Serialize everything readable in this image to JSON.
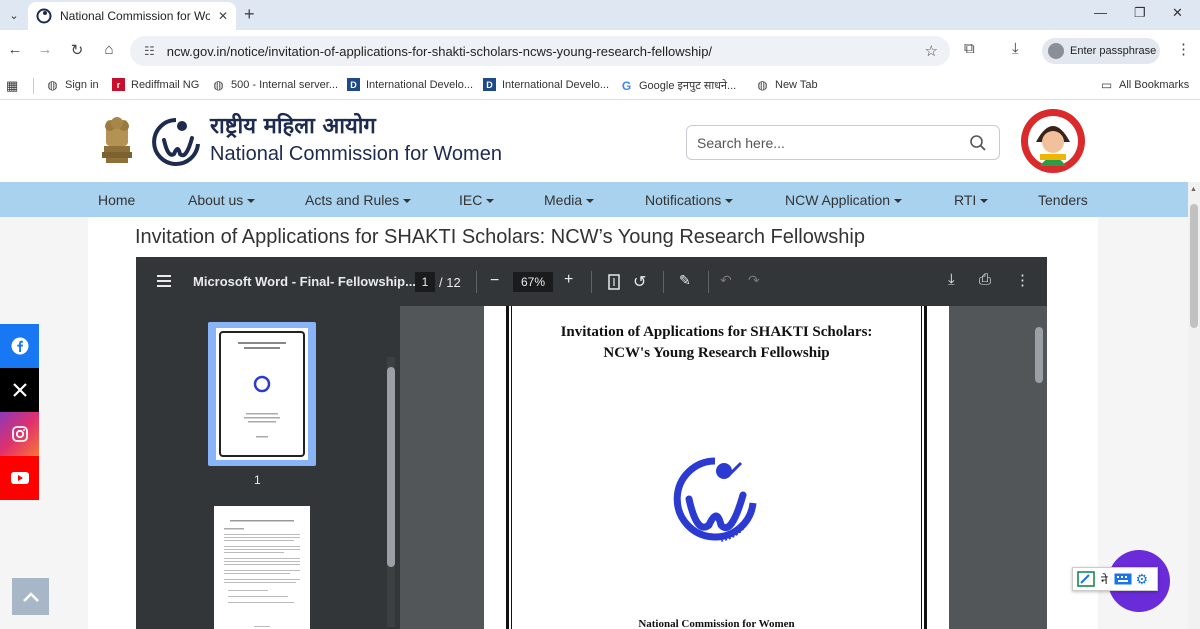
{
  "browser": {
    "tab_title": "National Commission for Women",
    "new_tab_symbol": "+",
    "url": "ncw.gov.in/notice/invitation-of-applications-for-shakti-scholars-ncws-young-research-fellowship/",
    "profile_label": "Enter passphrase"
  },
  "bookmarks": [
    {
      "label": "Sign in",
      "icon": "globe-icon"
    },
    {
      "label": "Rediffmail NG",
      "icon": "rediff-icon"
    },
    {
      "label": "500 - Internal server...",
      "icon": "globe-icon"
    },
    {
      "label": "International Develo...",
      "icon": "doc-icon"
    },
    {
      "label": "International Develo...",
      "icon": "doc-icon"
    },
    {
      "label": "Google इनपुट साधने...",
      "icon": "google-icon"
    },
    {
      "label": "New Tab",
      "icon": "globe-icon"
    }
  ],
  "bookmarks_all": "All Bookmarks",
  "site": {
    "hindi_title": "राष्ट्रीय महिला आयोग",
    "english_title": "National Commission for Women",
    "search_placeholder": "Search here..."
  },
  "nav": [
    {
      "label": "Home",
      "dropdown": false
    },
    {
      "label": "About us",
      "dropdown": true
    },
    {
      "label": "Acts and Rules",
      "dropdown": true
    },
    {
      "label": "IEC",
      "dropdown": true
    },
    {
      "label": "Media",
      "dropdown": true
    },
    {
      "label": "Notifications",
      "dropdown": true
    },
    {
      "label": "NCW Application",
      "dropdown": true
    },
    {
      "label": "RTI",
      "dropdown": true
    },
    {
      "label": "Tenders",
      "dropdown": false
    }
  ],
  "page_heading": "Invitation of Applications for SHAKTI Scholars: NCW’s Young Research Fellowship",
  "pdf": {
    "doc_title": "Microsoft Word - Final- Fellowship...",
    "current_page": "1",
    "total_pages": "/ 12",
    "zoom": "67%",
    "thumb_label": "1",
    "page_title_line1": "Invitation of Applications for SHAKTI Scholars:",
    "page_title_line2": "NCW's Young Research Fellowship",
    "page_footer": "National Commission for Women"
  },
  "colors": {
    "nav_bg": "#a9d2ee",
    "pdf_toolbar": "#323639",
    "pdf_bg": "#525659",
    "facebook": "#1877f2",
    "x": "#000000",
    "youtube": "#ff0000",
    "chat": "#6a2bd9"
  }
}
